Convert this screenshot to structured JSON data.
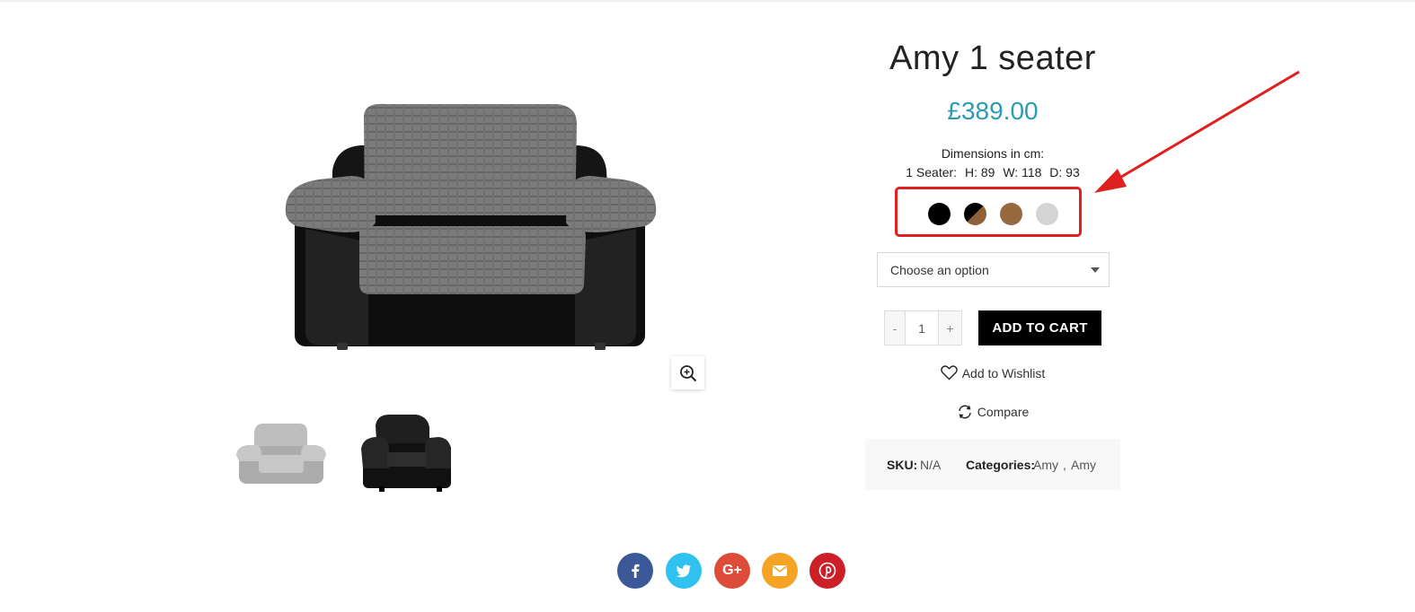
{
  "product": {
    "title": "Amy 1 seater",
    "price": "£389.00",
    "dimensions_heading": "Dimensions in cm:",
    "dimensions": {
      "label": "1 Seater:",
      "h": "H: 89",
      "w": "W: 118",
      "d": "D: 93"
    }
  },
  "gallery": {
    "zoom_icon": "zoom-in-icon",
    "thumbnails": [
      "grey-fabric-armchair",
      "black-leather-armchair"
    ]
  },
  "swatches": [
    {
      "name": "black",
      "colors": [
        "#000000"
      ]
    },
    {
      "name": "black-brown",
      "colors": [
        "#000000",
        "#8f6138"
      ]
    },
    {
      "name": "brown",
      "colors": [
        "#98693f"
      ]
    },
    {
      "name": "grey",
      "colors": [
        "#d4d4d4"
      ]
    }
  ],
  "variation": {
    "selected": "Choose an option"
  },
  "cart": {
    "minus": "-",
    "quantity": "1",
    "plus": "+",
    "add_to_cart": "ADD TO CART"
  },
  "actions": {
    "wishlist": "Add to Wishlist",
    "compare": "Compare"
  },
  "meta": {
    "sku_label": "SKU:",
    "sku_value": "N/A",
    "categories_label": "Categories:",
    "category_1": "Amy",
    "separator": ",",
    "category_2": "Amy"
  },
  "annotation": {
    "color": "#e0201e"
  },
  "social": [
    {
      "name": "facebook",
      "icon": "facebook-icon",
      "color": "#3b5998"
    },
    {
      "name": "twitter",
      "icon": "twitter-icon",
      "color": "#2fc2ef"
    },
    {
      "name": "google-plus",
      "icon": "google-plus-icon",
      "color": "#dd4b39"
    },
    {
      "name": "email",
      "icon": "email-icon",
      "color": "#f4a324"
    },
    {
      "name": "pinterest",
      "icon": "pinterest-icon",
      "color": "#cb2027"
    }
  ]
}
